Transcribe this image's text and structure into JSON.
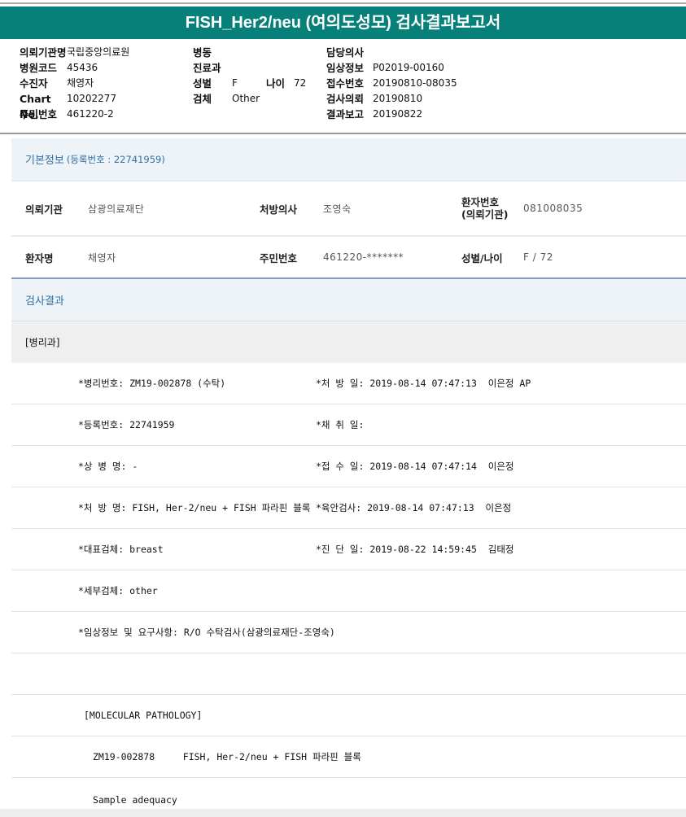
{
  "title": "FISH_Her2/neu (여의도성모) 검사결과보고서",
  "header_info": {
    "col1": [
      [
        "의뢰기관명",
        "국립중앙의료원"
      ],
      [
        "병원코드",
        "45436"
      ],
      [
        "수진자",
        "채영자"
      ],
      [
        "Chart No.",
        "10202277"
      ],
      [
        "주민번호",
        "461220-2"
      ]
    ],
    "col2": [
      [
        "병동",
        ""
      ],
      [
        "진료과",
        ""
      ],
      [
        "성별",
        "F"
      ],
      [
        "검체",
        "Other"
      ]
    ],
    "age_label": "나이",
    "age_value": "72",
    "col3": [
      [
        "담당의사",
        ""
      ],
      [
        "임상정보",
        "P02019-00160"
      ],
      [
        "접수번호",
        "20190810-08035"
      ],
      [
        "검사의뢰",
        "20190810"
      ],
      [
        "결과보고",
        "20190822"
      ]
    ]
  },
  "basic": {
    "title": "기본정보",
    "reg": "(등록번호 : 22741959)",
    "rows": [
      [
        [
          "의뢰기관",
          "삼광의료재단"
        ],
        [
          "처방의사",
          "조영숙"
        ],
        [
          "환자번호\n(의뢰기관)",
          "081008035"
        ]
      ],
      [
        [
          "환자명",
          "채영자"
        ],
        [
          "주민번호",
          "461220-*******"
        ],
        [
          "성별/나이",
          "F / 72"
        ]
      ]
    ]
  },
  "results": {
    "title": "검사결과",
    "dept": "[병리과]",
    "rows": [
      [
        "*병리번호: ZM19-002878 (수탁)",
        "*처 방 일: 2019-08-14 07:47:13  이은정 AP"
      ],
      [
        "*등록번호: 22741959",
        "*채 취 일:"
      ],
      [
        "*상 병 명: -",
        "*접 수 일: 2019-08-14 07:47:14  이은정"
      ],
      [
        "*처 방 명: FISH, Her-2/neu + FISH 파라핀 블록",
        "*육안검사: 2019-08-14 07:47:13  이은정"
      ],
      [
        "*대표검체: breast",
        "*진 단 일: 2019-08-22 14:59:45  김태정"
      ],
      [
        "*세부검체: other",
        ""
      ],
      [
        "*임상정보 및 요구사항: R/O 수탁검사(삼광의료재단-조영숙)",
        ""
      ],
      [
        "",
        ""
      ]
    ],
    "molecular": "[MOLECULAR PATHOLOGY]",
    "test_line": "ZM19-002878     FISH, Her-2/neu + FISH 파라핀 블록",
    "adequacy": "Sample adequacy"
  }
}
